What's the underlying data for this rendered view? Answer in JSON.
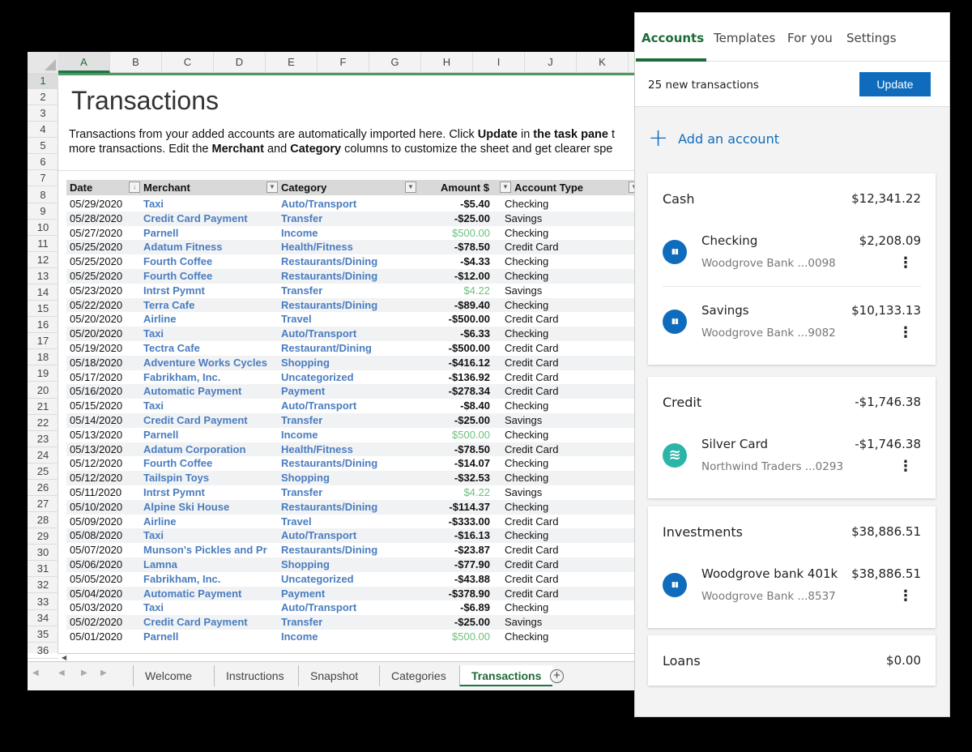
{
  "spreadsheet": {
    "columns": [
      "A",
      "B",
      "C",
      "D",
      "E",
      "F",
      "G",
      "H",
      "I",
      "J",
      "K"
    ],
    "row_numbers": [
      "1",
      "2",
      "3",
      "4",
      "5",
      "6",
      "7",
      "8",
      "9",
      "10",
      "11",
      "12",
      "13",
      "14",
      "15",
      "16",
      "17",
      "18",
      "19",
      "20",
      "21",
      "22",
      "23",
      "24",
      "25",
      "26",
      "27",
      "28",
      "29",
      "30",
      "31",
      "32",
      "33",
      "34",
      "35",
      "36"
    ],
    "title": "Transactions",
    "desc1": {
      "a": "Transactions from your added accounts are automatically imported here. Click ",
      "b": "Update",
      "c": " in ",
      "d": "the task pane",
      "e": " t"
    },
    "desc2": {
      "a": "more transactions. Edit the ",
      "b": "Merchant",
      "c": " and ",
      "d": "Category",
      "e": " columns to customize the sheet and get clearer spe"
    },
    "headers": {
      "date": "Date",
      "merchant": "Merchant",
      "category": "Category",
      "amount": "Amount $",
      "account_type": "Account Type"
    },
    "rows": [
      [
        "05/29/2020",
        "Taxi",
        "Auto/Transport",
        "-$5.40",
        "Checking"
      ],
      [
        "05/28/2020",
        "Credit Card Payment",
        "Transfer",
        "-$25.00",
        "Savings"
      ],
      [
        "05/27/2020",
        "Parnell",
        "Income",
        "$500.00",
        "Checking"
      ],
      [
        "05/25/2020",
        "Adatum Fitness",
        "Health/Fitness",
        "-$78.50",
        "Credit Card"
      ],
      [
        "05/25/2020",
        "Fourth Coffee",
        "Restaurants/Dining",
        "-$4.33",
        "Checking"
      ],
      [
        "05/25/2020",
        "Fourth Coffee",
        "Restaurants/Dining",
        "-$12.00",
        "Checking"
      ],
      [
        "05/23/2020",
        "Intrst Pymnt",
        "Transfer",
        "$4.22",
        "Savings"
      ],
      [
        "05/22/2020",
        "Terra Cafe",
        "Restaurants/Dining",
        "-$89.40",
        "Checking"
      ],
      [
        "05/20/2020",
        "Airline",
        "Travel",
        "-$500.00",
        "Credit Card"
      ],
      [
        "05/20/2020",
        "Taxi",
        "Auto/Transport",
        "-$6.33",
        "Checking"
      ],
      [
        "05/19/2020",
        "Tectra Cafe",
        "Restaurant/Dining",
        "-$500.00",
        "Credit Card"
      ],
      [
        "05/18/2020",
        "Adventure Works Cycles",
        "Shopping",
        "-$416.12",
        "Credit Card"
      ],
      [
        "05/17/2020",
        "Fabrikham, Inc.",
        "Uncategorized",
        "-$136.92",
        "Credit Card"
      ],
      [
        "05/16/2020",
        "Automatic Payment",
        "Payment",
        "-$278.34",
        "Credit Card"
      ],
      [
        "05/15/2020",
        "Taxi",
        "Auto/Transport",
        "-$8.40",
        "Checking"
      ],
      [
        "05/14/2020",
        "Credit Card Payment",
        "Transfer",
        "-$25.00",
        "Savings"
      ],
      [
        "05/13/2020",
        "Parnell",
        "Income",
        "$500.00",
        "Checking"
      ],
      [
        "05/13/2020",
        "Adatum Corporation",
        "Health/Fitness",
        "-$78.50",
        "Credit Card"
      ],
      [
        "05/12/2020",
        "Fourth Coffee",
        "Restaurants/Dining",
        "-$14.07",
        "Checking"
      ],
      [
        "05/12/2020",
        "Tailspin Toys",
        "Shopping",
        "-$32.53",
        "Checking"
      ],
      [
        "05/11/2020",
        "Intrst Pymnt",
        "Transfer",
        "$4.22",
        "Savings"
      ],
      [
        "05/10/2020",
        "Alpine Ski House",
        "Restaurants/Dining",
        "-$114.37",
        "Checking"
      ],
      [
        "05/09/2020",
        "Airline",
        "Travel",
        "-$333.00",
        "Credit Card"
      ],
      [
        "05/08/2020",
        "Taxi",
        "Auto/Transport",
        "-$16.13",
        "Checking"
      ],
      [
        "05/07/2020",
        "Munson's Pickles and Pr",
        "Restaurants/Dining",
        "-$23.87",
        "Credit Card"
      ],
      [
        "05/06/2020",
        "Lamna",
        "Shopping",
        "-$77.90",
        "Credit Card"
      ],
      [
        "05/05/2020",
        "Fabrikham, Inc.",
        "Uncategorized",
        "-$43.88",
        "Credit Card"
      ],
      [
        "05/04/2020",
        "Automatic Payment",
        "Payment",
        "-$378.90",
        "Credit Card"
      ],
      [
        "05/03/2020",
        "Taxi",
        "Auto/Transport",
        "-$6.89",
        "Checking"
      ],
      [
        "05/02/2020",
        "Credit Card Payment",
        "Transfer",
        "-$25.00",
        "Savings"
      ],
      [
        "05/01/2020",
        "Parnell",
        "Income",
        "$500.00",
        "Checking"
      ]
    ],
    "sheet_tabs": [
      "Welcome",
      "Instructions",
      "Snapshot",
      "Categories",
      "Transactions"
    ],
    "active_sheet": "Transactions",
    "colors": {
      "link": "#4a7dbf",
      "positive": "#6cc07e",
      "accent": "#217346"
    }
  },
  "pane": {
    "tabs": [
      "Accounts",
      "Templates",
      "For you",
      "Settings"
    ],
    "active_tab": "Accounts",
    "new_transactions": "25 new transactions",
    "update_label": "Update",
    "add_account_label": "Add an account",
    "groups": [
      {
        "name": "Cash",
        "total": "$12,341.22",
        "accounts": [
          {
            "name": "Checking",
            "bank": "Woodgrove Bank ...0098",
            "balance": "$2,208.09",
            "icon": "bank-icon"
          },
          {
            "name": "Savings",
            "bank": "Woodgrove Bank ...9082",
            "balance": "$10,133.13",
            "icon": "bank-icon"
          }
        ]
      },
      {
        "name": "Credit",
        "total": "-$1,746.38",
        "accounts": [
          {
            "name": "Silver Card",
            "bank": "Northwind Traders ...0293",
            "balance": "-$1,746.38",
            "icon": "wind-icon"
          }
        ]
      },
      {
        "name": "Investments",
        "total": "$38,886.51",
        "accounts": [
          {
            "name": "Woodgrove bank 401k",
            "bank": "Woodgrove Bank ...8537",
            "balance": "$38,886.51",
            "icon": "bank-icon"
          }
        ]
      },
      {
        "name": "Loans",
        "total": "$0.00",
        "accounts": []
      }
    ],
    "colors": {
      "accent": "#1e6b3a",
      "button": "#0f6cbd",
      "bank_icon": "#0f6cbd",
      "wind_icon": "#2bb5a7"
    }
  }
}
